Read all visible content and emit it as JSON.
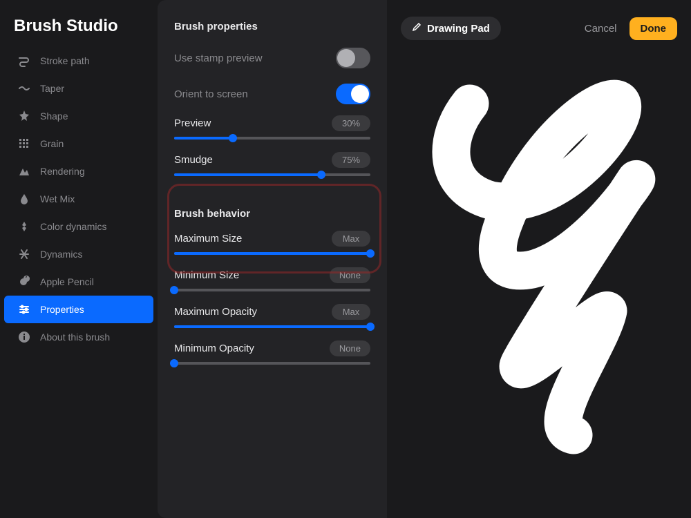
{
  "app_title": "Brush Studio",
  "sidebar": {
    "items": [
      {
        "label": "Stroke path",
        "icon": "stroke-path"
      },
      {
        "label": "Taper",
        "icon": "taper"
      },
      {
        "label": "Shape",
        "icon": "shape"
      },
      {
        "label": "Grain",
        "icon": "grain"
      },
      {
        "label": "Rendering",
        "icon": "rendering"
      },
      {
        "label": "Wet Mix",
        "icon": "wet-mix"
      },
      {
        "label": "Color dynamics",
        "icon": "color-dynamics"
      },
      {
        "label": "Dynamics",
        "icon": "dynamics"
      },
      {
        "label": "Apple Pencil",
        "icon": "apple-pencil"
      },
      {
        "label": "Properties",
        "icon": "properties",
        "selected": true
      },
      {
        "label": "About this brush",
        "icon": "about"
      }
    ]
  },
  "panel": {
    "section1_title": "Brush properties",
    "use_stamp_preview_label": "Use stamp preview",
    "use_stamp_preview_on": false,
    "orient_to_screen_label": "Orient to screen",
    "orient_to_screen_on": true,
    "preview": {
      "label": "Preview",
      "value": "30%",
      "percent": 30
    },
    "smudge": {
      "label": "Smudge",
      "value": "75%",
      "percent": 75
    },
    "section2_title": "Brush behavior",
    "max_size": {
      "label": "Maximum Size",
      "value": "Max",
      "percent": 100
    },
    "min_size": {
      "label": "Minimum Size",
      "value": "None",
      "percent": 0
    },
    "max_opacity": {
      "label": "Maximum Opacity",
      "value": "Max",
      "percent": 100
    },
    "min_opacity": {
      "label": "Minimum Opacity",
      "value": "None",
      "percent": 0
    }
  },
  "topbar": {
    "drawing_pad": "Drawing Pad",
    "cancel": "Cancel",
    "done": "Done"
  }
}
